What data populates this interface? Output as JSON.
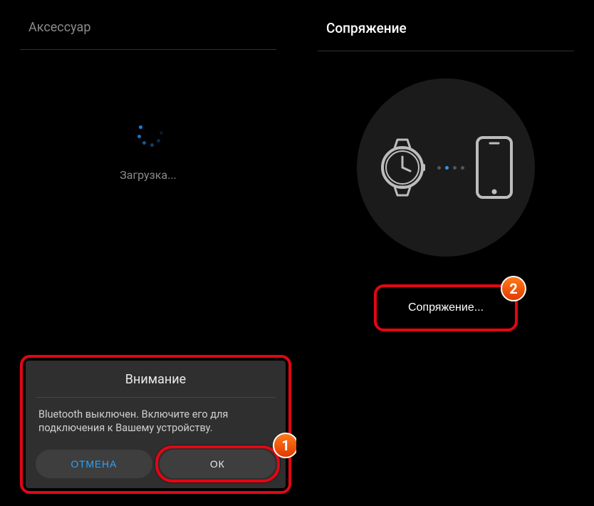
{
  "left": {
    "title": "Аксессуар",
    "loading_label": "Загрузка...",
    "dialog": {
      "title": "Внимание",
      "message": "Bluetooth выключен. Включите его для подключения к Вашему устройству.",
      "cancel": "ОТМЕНА",
      "ok": "ОК"
    },
    "badge": "1"
  },
  "right": {
    "title": "Сопряжение",
    "pair_button": "Сопряжение...",
    "badge": "2"
  }
}
